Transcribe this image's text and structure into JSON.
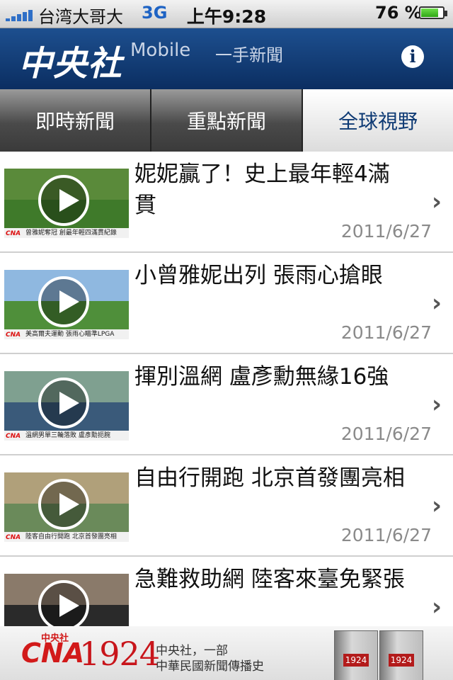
{
  "status_bar": {
    "carrier": "台湾大哥大",
    "network": "3G",
    "time": "上午9:28",
    "battery_percent": "76 %",
    "battery_level": 0.76,
    "signal_bars": 5
  },
  "header": {
    "logo": "中央社",
    "mobile_label": "Mobile",
    "tagline": "一手新聞",
    "info_icon": "info-icon"
  },
  "tabs": [
    {
      "label": "即時新聞",
      "active": false
    },
    {
      "label": "重點新聞",
      "active": false
    },
    {
      "label": "全球視野",
      "active": true
    }
  ],
  "news": [
    {
      "title": "妮妮贏了！史上最年輕4滿貫",
      "date": "2011/6/27",
      "thumb_caption": "曾雅妮奪冠 創最年輕四滿貫紀錄",
      "sky": "#5a8a3a",
      "ground": "#3f7a2a"
    },
    {
      "title": "小曾雅妮出列 張雨心搶眼",
      "date": "2011/6/27",
      "thumb_caption": "美高爾夫運動 張雨心瞄準LPGA",
      "sky": "#8fb8e0",
      "ground": "#4f8f3a"
    },
    {
      "title": "揮別溫網 盧彥勳無緣16強",
      "date": "2011/6/27",
      "thumb_caption": "溫網男單三輪落敗 盧彥勳扼腕",
      "sky": "#7fa090",
      "ground": "#3a5a7a"
    },
    {
      "title": "自由行開跑 北京首發團亮相",
      "date": "2011/6/27",
      "thumb_caption": "陸客自由行開跑 北京首發團亮相",
      "sky": "#b0a07a",
      "ground": "#6a8a5a"
    },
    {
      "title": "急難救助網 陸客來臺免緊張",
      "date": "",
      "thumb_caption": "",
      "sky": "#8a7a6a",
      "ground": "#2a2a2a"
    }
  ],
  "ad": {
    "logo": "CNA",
    "logo_sub": "中央社",
    "year": "1924",
    "line1": "中央社，一部",
    "line2": "中華民國新聞傳播史",
    "book_label": "1924"
  }
}
